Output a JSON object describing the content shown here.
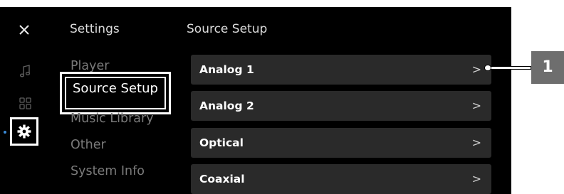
{
  "header": {
    "close_icon": "close-icon",
    "settings_title": "Settings",
    "panel_title": "Source Setup"
  },
  "sidebar": {
    "icons": [
      "music-note-icon",
      "grid-icon",
      "gear-icon"
    ],
    "selected_icon": "gear-icon"
  },
  "settings_menu": {
    "items": [
      {
        "label": "Player"
      },
      {
        "label": "Source Setup",
        "selected": true
      },
      {
        "label": "Music Library"
      },
      {
        "label": "Other"
      },
      {
        "label": "System Info"
      }
    ]
  },
  "source_list": {
    "items": [
      {
        "label": "Analog 1",
        "chevron": ">"
      },
      {
        "label": "Analog 2",
        "chevron": ">"
      },
      {
        "label": "Optical",
        "chevron": ">"
      },
      {
        "label": "Coaxial",
        "chevron": ">"
      }
    ]
  },
  "callout": {
    "number": "1"
  },
  "colors": {
    "screen_bg": "#000000",
    "row_bg": "#2a2a2a",
    "text_active": "#ffffff",
    "text_inactive": "#7a7a7a",
    "badge_bg": "#6e6e6e"
  }
}
